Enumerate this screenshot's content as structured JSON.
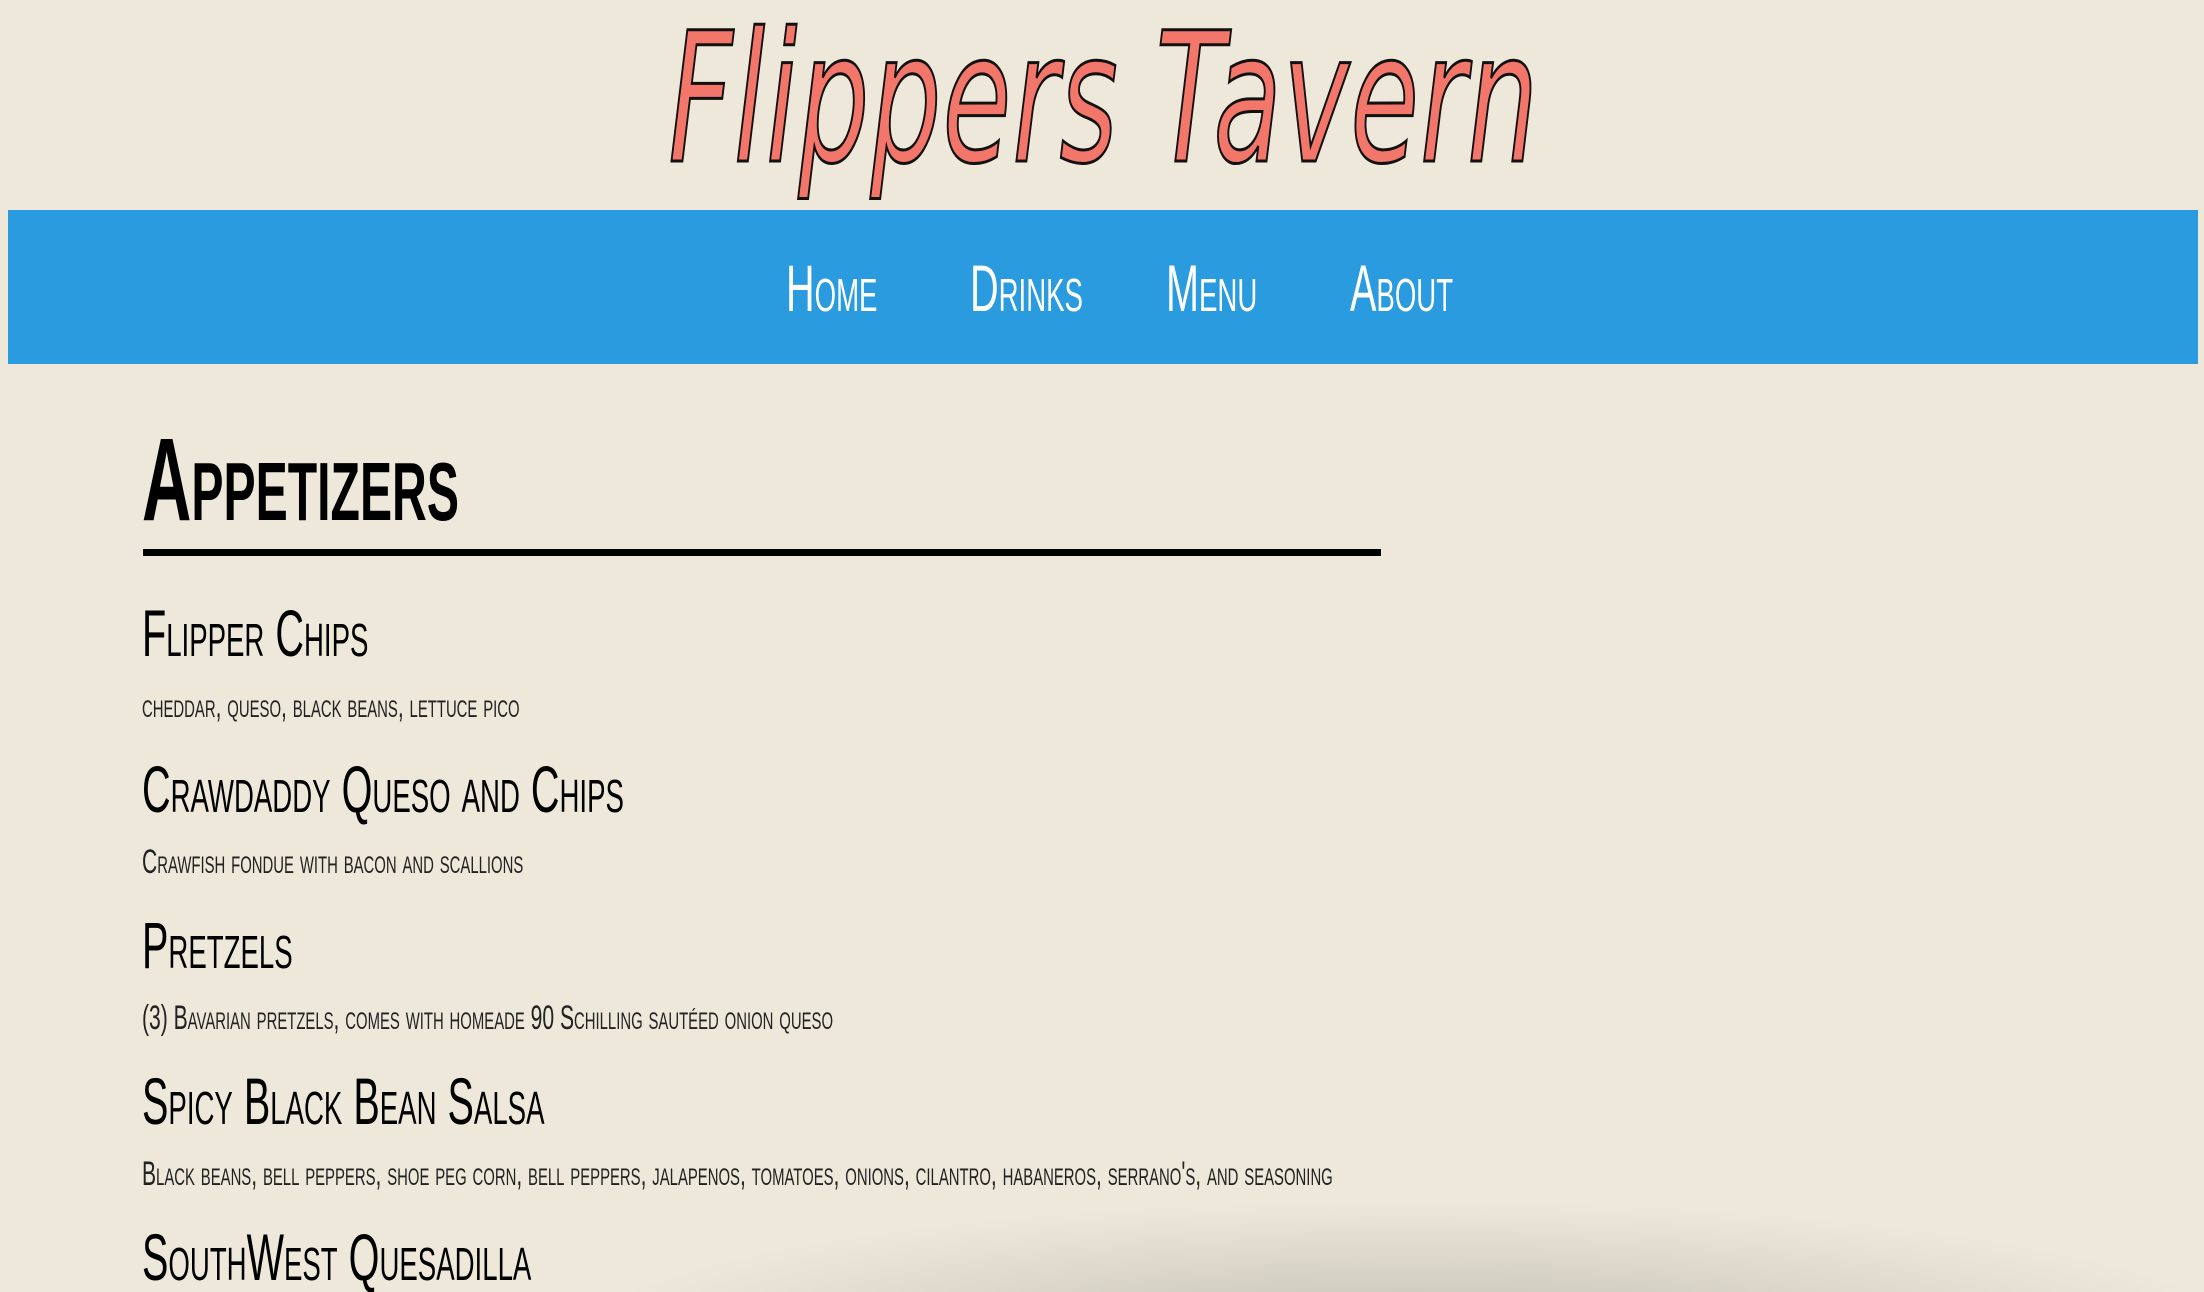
{
  "header": {
    "site_title": "Flippers Tavern"
  },
  "nav": {
    "items": [
      {
        "label": "Home"
      },
      {
        "label": "Drinks"
      },
      {
        "label": "Menu"
      },
      {
        "label": "About"
      }
    ]
  },
  "colors": {
    "background": "#ede8da",
    "nav_bar": "#299bde",
    "title": "#f2766a",
    "text": "#000000"
  },
  "section": {
    "title": "Appetizers",
    "items": [
      {
        "name": "Flipper Chips",
        "description": "cheddar, queso, black beans, lettuce pico"
      },
      {
        "name": "Crawdaddy Queso and Chips",
        "description": "Crawfish fondue with bacon and scallions"
      },
      {
        "name": "Pretzels",
        "description": "(3) Bavarian pretzels, comes with homeade 90 Schilling sautéed onion queso"
      },
      {
        "name": "Spicy Black Bean Salsa",
        "description": "Black beans, bell peppers, shoe peg corn, bell peppers, jalapenos, tomatoes, onions, cilantro, habaneros, serrano's, and seasoning"
      },
      {
        "name": "SouthWest Quesadilla",
        "description": ""
      }
    ]
  }
}
